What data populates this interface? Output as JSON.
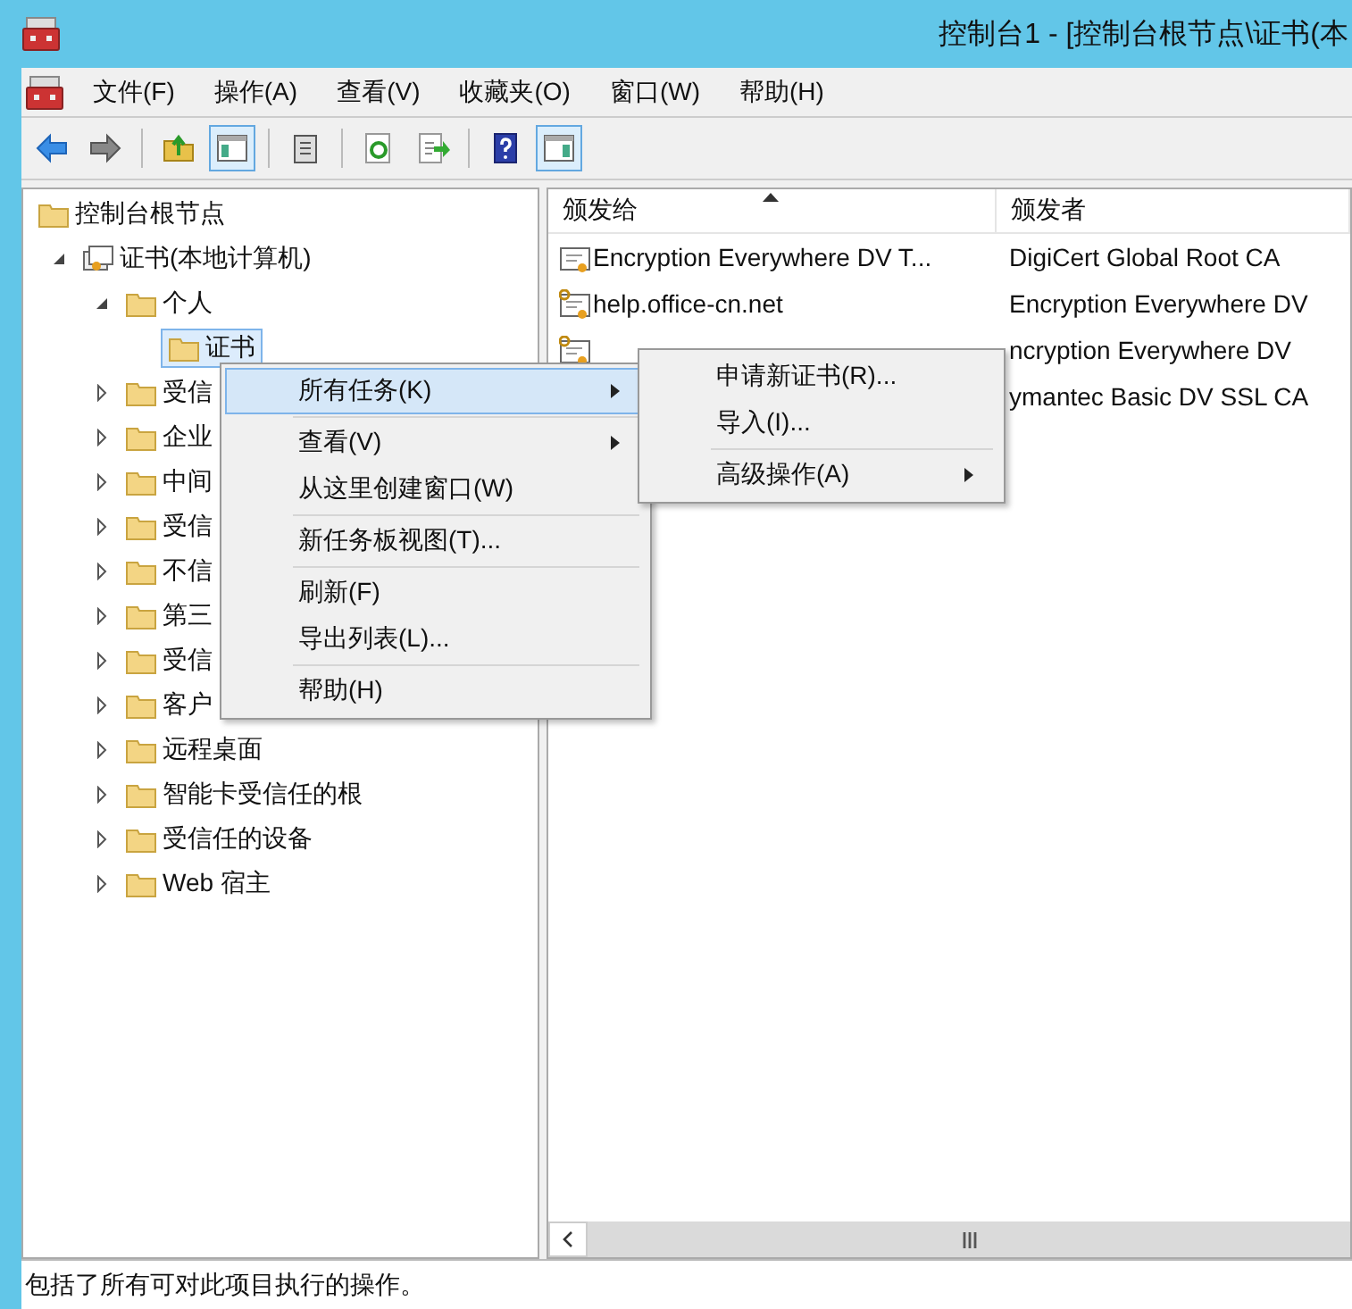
{
  "window": {
    "title": "控制台1 - [控制台根节点\\证书(本"
  },
  "menu_bar": [
    "文件(F)",
    "操作(A)",
    "查看(V)",
    "收藏夹(O)",
    "窗口(W)",
    "帮助(H)"
  ],
  "toolbar": [
    {
      "kind": "back",
      "pressed": false
    },
    {
      "kind": "forward",
      "pressed": false
    },
    {
      "kind": "sep"
    },
    {
      "kind": "up",
      "pressed": false
    },
    {
      "kind": "tree-toggle",
      "pressed": true
    },
    {
      "kind": "sep"
    },
    {
      "kind": "clipboard",
      "pressed": false
    },
    {
      "kind": "sep"
    },
    {
      "kind": "refresh",
      "pressed": false
    },
    {
      "kind": "export",
      "pressed": false
    },
    {
      "kind": "sep"
    },
    {
      "kind": "help",
      "pressed": false
    },
    {
      "kind": "pane-toggle",
      "pressed": true
    }
  ],
  "tree": [
    {
      "label": "控制台根节点",
      "kind": "root",
      "selected": false,
      "children": [
        {
          "label": "证书(本地计算机)",
          "kind": "store",
          "expanded": true,
          "selected": false,
          "children": [
            {
              "label": "个人",
              "kind": "folder",
              "expanded": true,
              "selected": false,
              "children": [
                {
                  "label": "证书",
                  "kind": "folder",
                  "selected": true
                }
              ]
            },
            {
              "label": "受信",
              "kind": "folder",
              "expanded": false,
              "selected": false
            },
            {
              "label": "企业",
              "kind": "folder",
              "expanded": false,
              "selected": false
            },
            {
              "label": "中间",
              "kind": "folder",
              "expanded": false,
              "selected": false
            },
            {
              "label": "受信",
              "kind": "folder",
              "expanded": false,
              "selected": false
            },
            {
              "label": "不信",
              "kind": "folder",
              "expanded": false,
              "selected": false
            },
            {
              "label": "第三",
              "kind": "folder",
              "expanded": false,
              "selected": false
            },
            {
              "label": "受信",
              "kind": "folder",
              "expanded": false,
              "selected": false
            },
            {
              "label": "客户",
              "kind": "folder",
              "expanded": false,
              "selected": false
            },
            {
              "label": "远程桌面",
              "kind": "folder",
              "expanded": false,
              "selected": false
            },
            {
              "label": "智能卡受信任的根",
              "kind": "folder",
              "expanded": false,
              "selected": false
            },
            {
              "label": "受信任的设备",
              "kind": "folder",
              "expanded": false,
              "selected": false
            },
            {
              "label": "Web 宿主",
              "kind": "folder",
              "expanded": false,
              "selected": false
            }
          ]
        }
      ]
    }
  ],
  "table": {
    "columns": [
      {
        "label": "颁发给",
        "sorted": true
      },
      {
        "label": "颁发者",
        "sorted": false
      }
    ],
    "rows": [
      {
        "kind": "cert",
        "issued_to": "Encryption Everywhere DV T...",
        "issued_by": "DigiCert Global Root CA"
      },
      {
        "kind": "key-cert",
        "issued_to": "help.office-cn.net",
        "issued_by": "Encryption Everywhere DV"
      },
      {
        "kind": "key-cert",
        "issued_by": "ncryption Everywhere DV"
      },
      {
        "kind": "none",
        "issued_by": "ymantec Basic DV SSL CA"
      }
    ]
  },
  "context_menu": {
    "groups": [
      [
        {
          "label": "所有任务(K)",
          "submenu": true,
          "selected": true
        }
      ],
      [
        {
          "label": "查看(V)",
          "submenu": true,
          "selected": false
        },
        {
          "label": "从这里创建窗口(W)",
          "submenu": false,
          "selected": false
        }
      ],
      [
        {
          "label": "新任务板视图(T)...",
          "submenu": false,
          "selected": false
        }
      ],
      [
        {
          "label": "刷新(F)",
          "submenu": false,
          "selected": false
        },
        {
          "label": "导出列表(L)...",
          "submenu": false,
          "selected": false
        }
      ],
      [
        {
          "label": "帮助(H)",
          "submenu": false,
          "selected": false
        }
      ]
    ]
  },
  "submenu": {
    "groups": [
      [
        {
          "label": "申请新证书(R)...",
          "submenu": false,
          "selected": false
        },
        {
          "label": "导入(I)...",
          "submenu": false,
          "selected": false
        }
      ],
      [
        {
          "label": "高级操作(A)",
          "submenu": true,
          "selected": false
        }
      ]
    ]
  },
  "status_bar": "包括了所有可对此项目执行的操作。"
}
